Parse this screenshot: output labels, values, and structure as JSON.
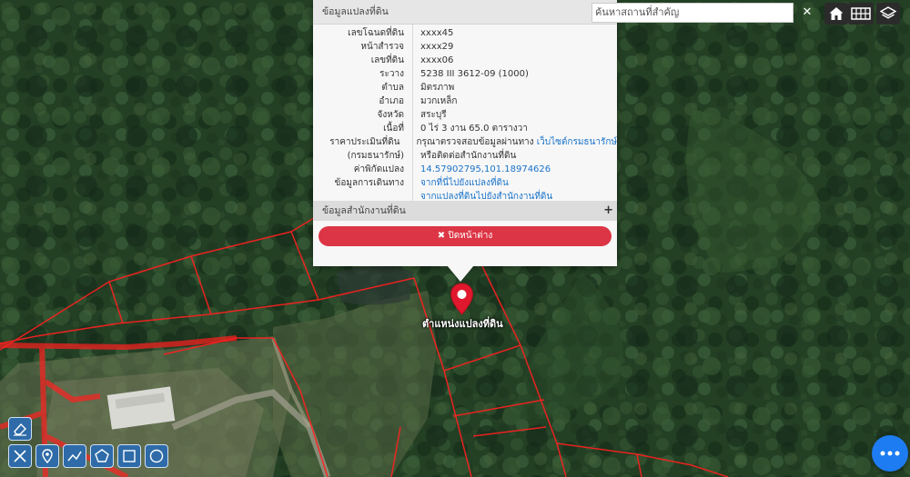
{
  "popup": {
    "title": "ข้อมูลแปลงที่ดิน",
    "rows": [
      {
        "k": "เลขโฉนดที่ดิน",
        "v": "xxxx45"
      },
      {
        "k": "หน้าสำรวจ",
        "v": "xxxx29"
      },
      {
        "k": "เลขที่ดิน",
        "v": "xxxx06"
      },
      {
        "k": "ระวาง",
        "v": "5238 III 3612-09 (1000)"
      },
      {
        "k": "ตำบล",
        "v": "มิตรภาพ"
      },
      {
        "k": "อำเภอ",
        "v": "มวกเหล็ก"
      },
      {
        "k": "จังหวัด",
        "v": "สระบุรี"
      },
      {
        "k": "เนื้อที่",
        "v": "0 ไร่ 3 งาน 65.0 ตารางวา"
      },
      {
        "k": "ราคาประเมินที่ดิน",
        "v": "กรุณาตรวจสอบข้อมูลผ่านทาง ",
        "v_link": "เว็บไซต์กรมธนารักษ์"
      },
      {
        "k": "(กรมธนารักษ์)",
        "v": "หรือติดต่อสำนักงานที่ดิน"
      },
      {
        "k": "ค่าพิกัดแปลง",
        "v_link": "14.57902795,101.18974626"
      },
      {
        "k": "ข้อมูลการเดินทาง",
        "v_link": "จากที่นี่ไปยังแปลงที่ดิน"
      },
      {
        "k": "",
        "v_link": "จากแปลงที่ดินไปยังสำนักงานที่ดิน"
      }
    ],
    "section2_title": "ข้อมูลสำนักงานที่ดิน",
    "close_label": "ปิดหน้าต่าง"
  },
  "search": {
    "placeholder": "ค้นหาสถานที่สำคัญ"
  },
  "marker": {
    "label": "ตำแหน่งแปลงที่ดิน"
  },
  "icons": {
    "home": "home-icon",
    "grid": "grid-icon",
    "layers": "layers-icon",
    "marker": "map-marker-icon",
    "fab": "more-icon"
  },
  "colors": {
    "accent": "#dc3545",
    "link": "#1a73c9",
    "tool": "#2e6ba8",
    "fab": "#1e7cf2",
    "parcel": "#ff2020"
  }
}
